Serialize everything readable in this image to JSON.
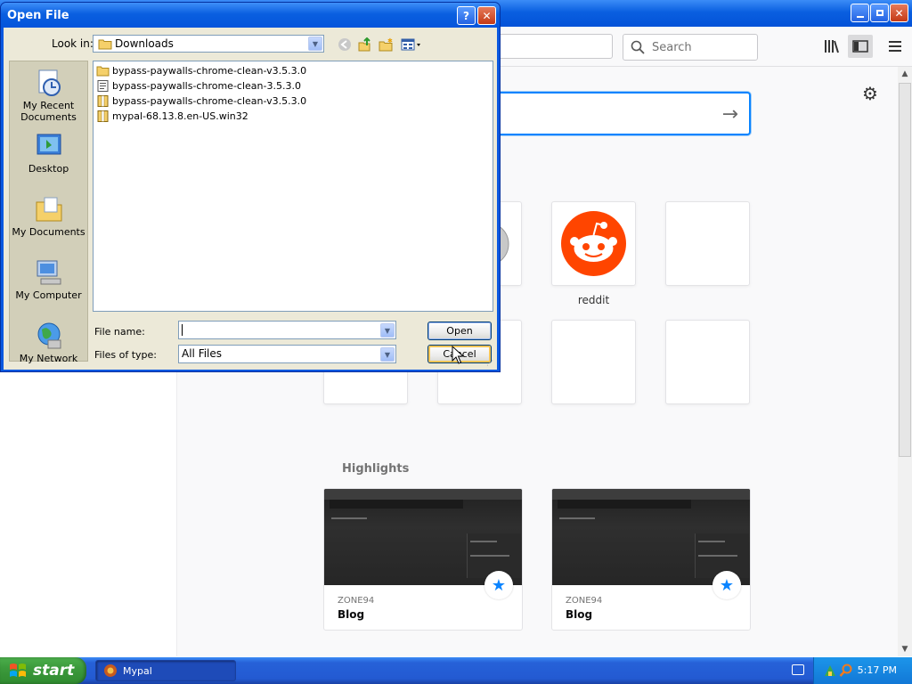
{
  "dialog": {
    "title": "Open File",
    "help_btn": "?",
    "close_btn": "✕",
    "look_in_label": "Look in:",
    "look_in_value": "Downloads",
    "places": [
      {
        "label": "My Recent Documents"
      },
      {
        "label": "Desktop"
      },
      {
        "label": "My Documents"
      },
      {
        "label": "My Computer"
      },
      {
        "label": "My Network"
      }
    ],
    "files": [
      {
        "name": "bypass-paywalls-chrome-clean-v3.5.3.0",
        "icon": "folder-icon"
      },
      {
        "name": "bypass-paywalls-chrome-clean-3.5.3.0",
        "icon": "document-icon"
      },
      {
        "name": "bypass-paywalls-chrome-clean-v3.5.3.0",
        "icon": "zip-archive-icon"
      },
      {
        "name": "mypal-68.13.8.en-US.win32",
        "icon": "zip-archive-icon"
      }
    ],
    "file_name_label": "File name:",
    "file_name_value": "",
    "files_of_type_label": "Files of type:",
    "files_of_type_value": "All Files",
    "open_btn": "Open",
    "cancel_btn": "Cancel"
  },
  "browser": {
    "search_placeholder": "Search",
    "tiles": [
      {
        "label": "reddit"
      }
    ],
    "highlights_title": "Highlights",
    "highlights": [
      {
        "domain": "ZONE94",
        "title": "Blog"
      },
      {
        "domain": "ZONE94",
        "title": "Blog"
      }
    ]
  },
  "taskbar": {
    "start_label": "start",
    "task_label": "Mypal",
    "clock": "5:17 PM"
  },
  "colors": {
    "xp_blue": "#0a5fe0",
    "dialog_face": "#ece9d8",
    "reddit_orange": "#ff4500",
    "focus_blue": "#0a84ff"
  }
}
